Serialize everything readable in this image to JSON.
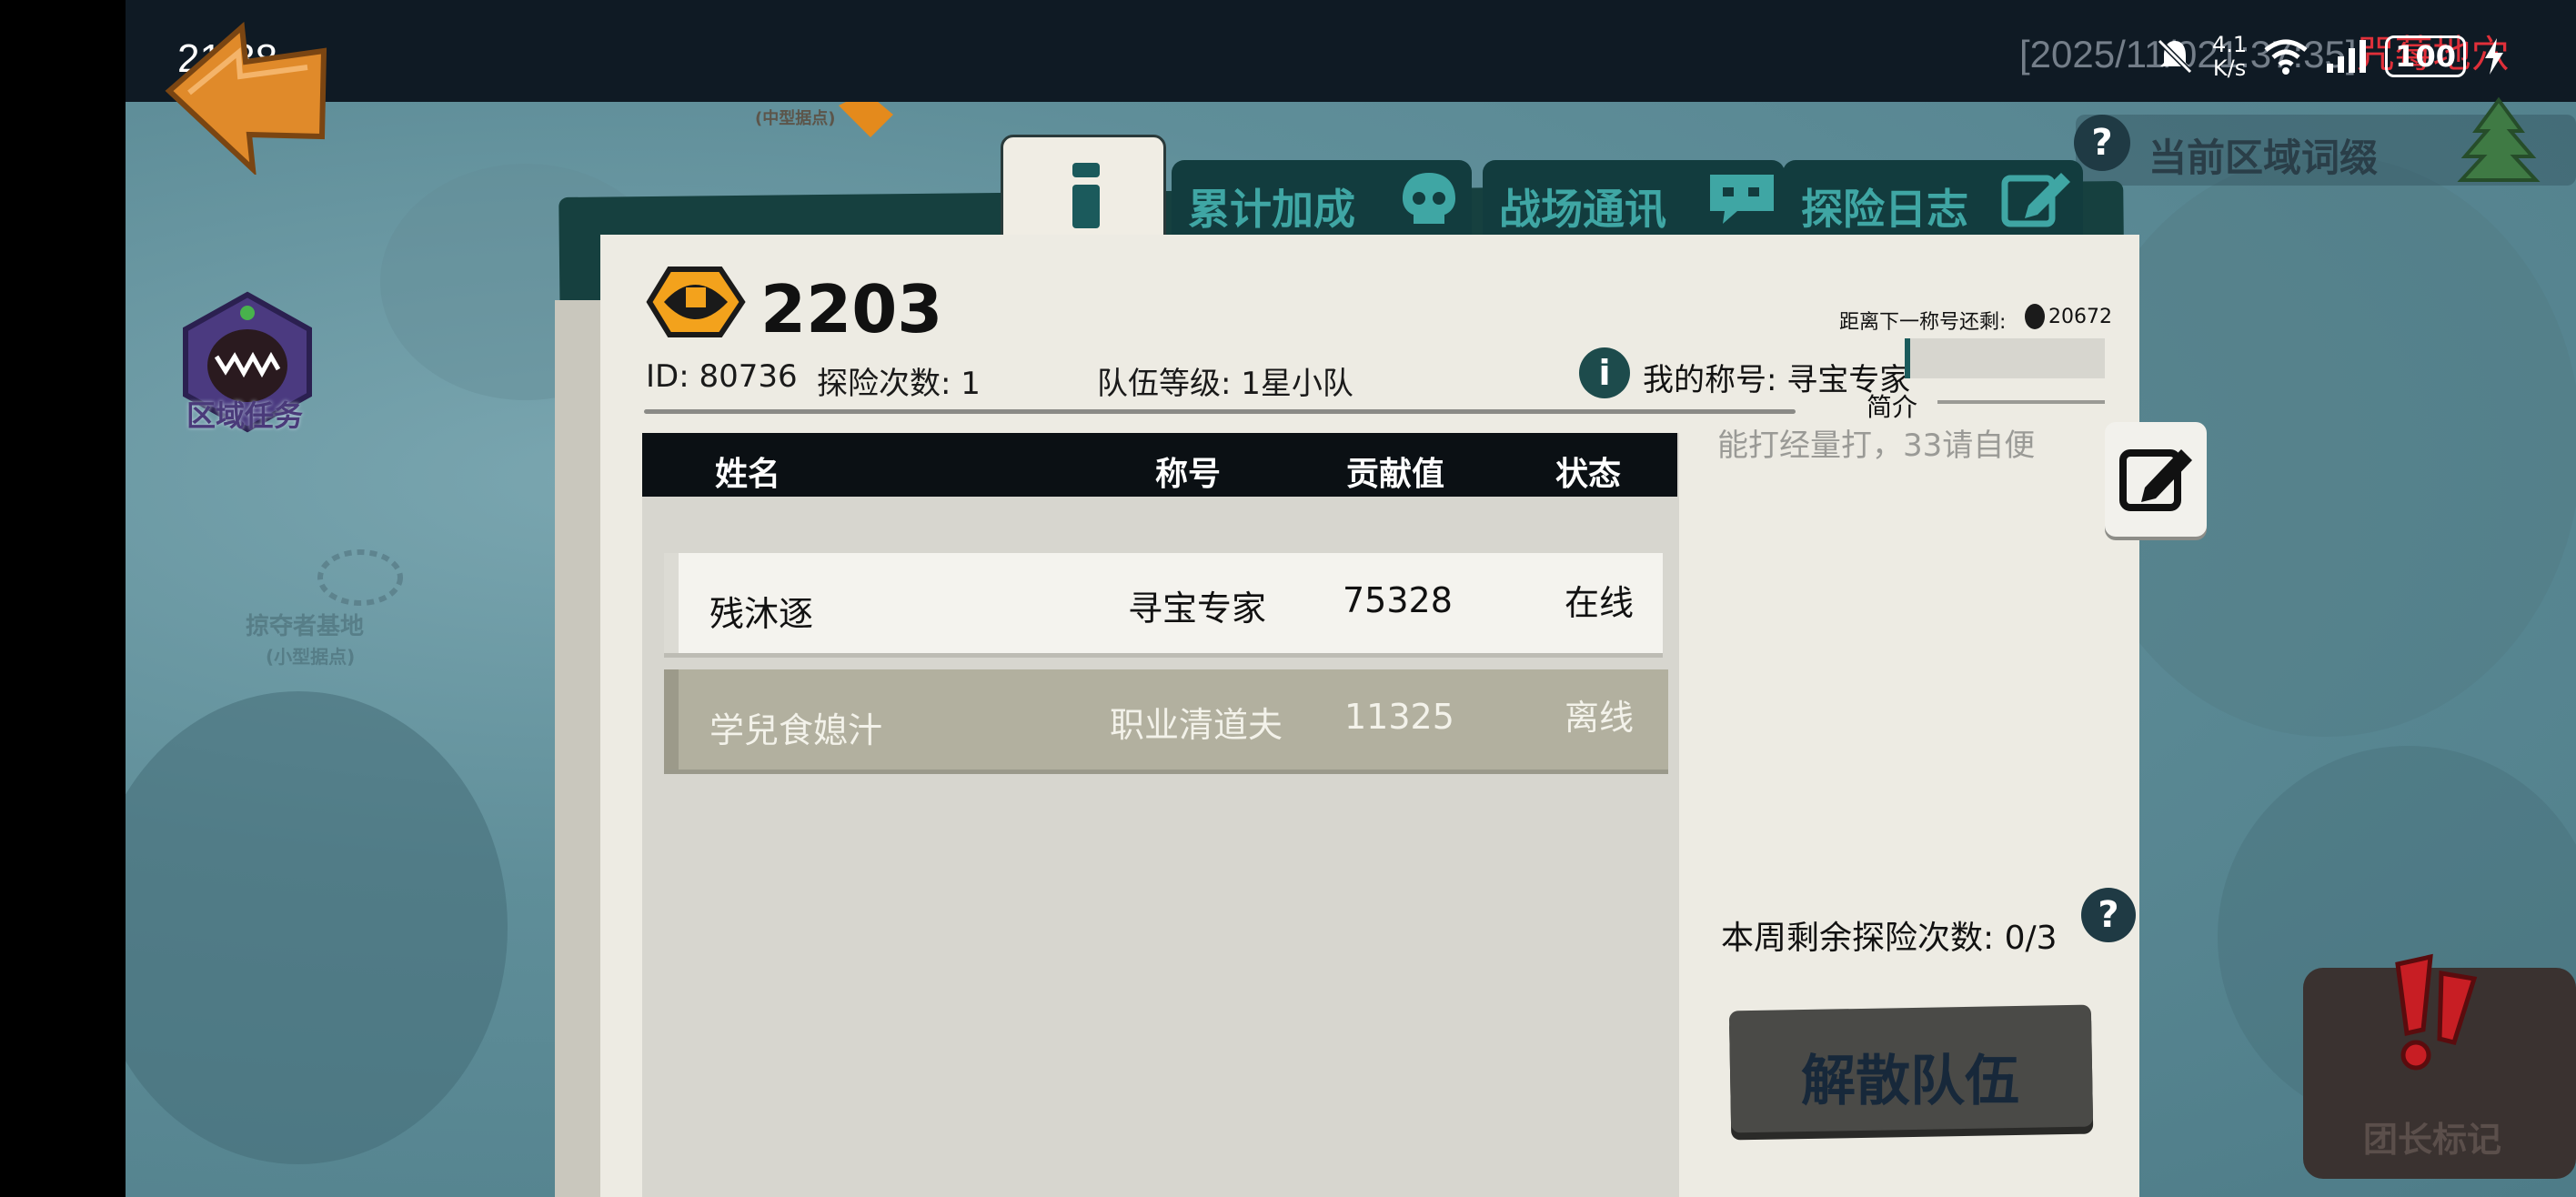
{
  "status_bar": {
    "time": "21:38",
    "timestamp_prefix": "[2025/11/0",
    "timestamp_mid": "21:37:35]",
    "timestamp_red": "咒莓地穴",
    "net_speed_value": "4.1",
    "net_speed_unit": "K/s",
    "battery": "100"
  },
  "map": {
    "region_task_label": "区域任务",
    "faded_label_1": "掠夺者基地",
    "faded_label_1_sub": "(小型据点)",
    "faded_label_2": "(中型据点)",
    "current_region_affix": "当前区域词缀"
  },
  "tabs": [
    {
      "label": "累计加成"
    },
    {
      "label": "战场通讯"
    },
    {
      "label": "探险日志"
    }
  ],
  "team": {
    "number": "2203",
    "id": "ID: 80736",
    "explore_count": "探险次数: 1",
    "team_level": "队伍等级: 1星小队",
    "next_title_label": "距离下一称号还剩:",
    "next_title_value": "20672",
    "my_title": "我的称号: 寻宝专家",
    "intro_label": "简介",
    "intro_text": "能打经量打，33请自便"
  },
  "table": {
    "headers": [
      "姓名",
      "称号",
      "贡献值",
      "状态"
    ],
    "rows": [
      {
        "name": "残沐逐",
        "title": "寻宝专家",
        "contribution": "75328",
        "status": "在线"
      },
      {
        "name": "学兒食媳汁",
        "title": "职业清道夫",
        "contribution": "11325",
        "status": "离线"
      }
    ]
  },
  "weekly_remaining": "本周剩余探险次数:  0/3",
  "disband_button": "解散队伍",
  "leader_mark": "团长标记",
  "colors": {
    "book_cover": "#16403f",
    "paper": "#edebe3",
    "tab_text": "#3fa6a4",
    "timestamp_red": "#e0303a"
  },
  "icons": [
    "back-arrow-icon",
    "region-task-monster-icon",
    "eye-icon",
    "info-icon",
    "question-icon",
    "edit-icon",
    "coin-icon",
    "tree-icon",
    "skull-icon",
    "chat-icon",
    "pencil-icon",
    "exclamation-icon"
  ]
}
